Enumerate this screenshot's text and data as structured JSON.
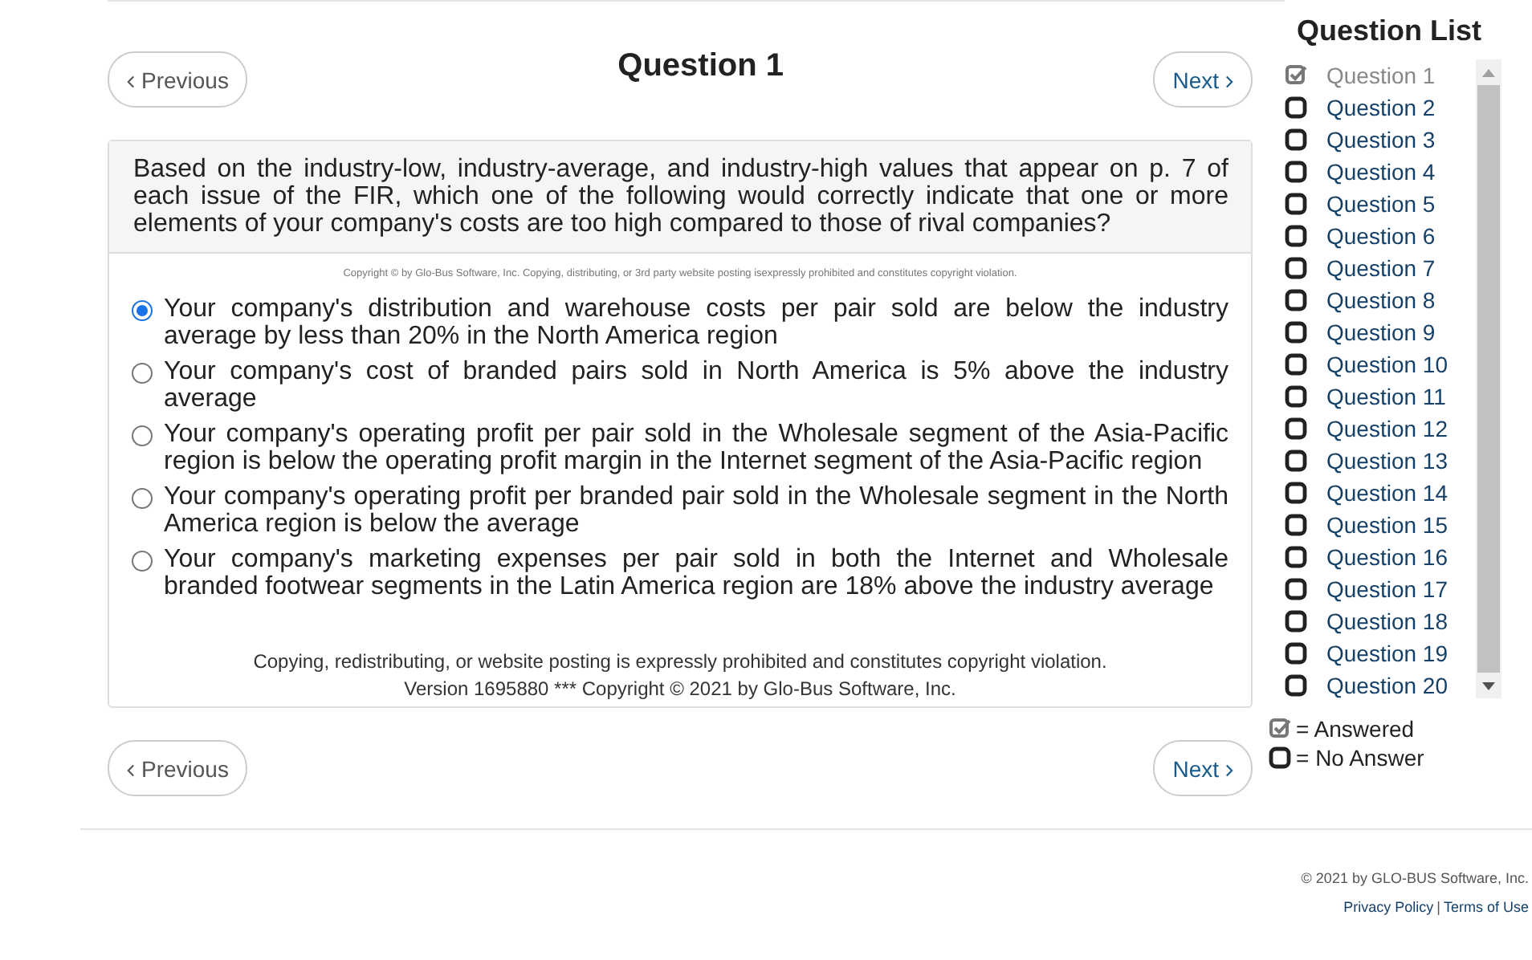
{
  "title": "Question 1",
  "nav_top": {
    "previous": "Previous",
    "next": "Next"
  },
  "question": {
    "text": "Based on the industry-low, industry-average, and industry-high values that appear on p. 7 of each issue of the FIR, which one of the following would correctly indicate that one or more elements of your company's costs are too high compared to those of rival companies?",
    "notice": "Copyright © by Glo-Bus Software, Inc. Copying, distributing, or 3rd party website posting isexpressly prohibited and constitutes copyright violation.",
    "options": [
      {
        "text": "Your company's distribution and warehouse costs per pair sold are below the industry average by less than 20% in the North America region",
        "selected": true
      },
      {
        "text": "Your company's cost of branded pairs sold in North America is 5% above the industry average",
        "selected": false
      },
      {
        "text": "Your company's operating profit per pair sold in the Wholesale segment of the Asia-Pacific region is below the operating profit margin in the Internet segment of the Asia-Pacific region",
        "selected": false
      },
      {
        "text": "Your company's operating profit per branded pair sold in the Wholesale segment in the North America region is below the average",
        "selected": false
      },
      {
        "text": "Your company's marketing expenses per pair sold in both the Internet and Wholesale branded footwear segments in the Latin America region are 18% above the industry average",
        "selected": false
      }
    ],
    "footer": [
      "Copying, redistributing, or website posting is expressly prohibited and constitutes copyright violation.",
      "Version 1695880 *** Copyright © 2021 by Glo-Bus Software, Inc."
    ]
  },
  "nav_bottom": {
    "previous": "Previous",
    "next": "Next"
  },
  "question_list": {
    "title": "Question List",
    "items": [
      {
        "label": "Question 1",
        "answered": true
      },
      {
        "label": "Question 2",
        "answered": false
      },
      {
        "label": "Question 3",
        "answered": false
      },
      {
        "label": "Question 4",
        "answered": false
      },
      {
        "label": "Question 5",
        "answered": false
      },
      {
        "label": "Question 6",
        "answered": false
      },
      {
        "label": "Question 7",
        "answered": false
      },
      {
        "label": "Question 8",
        "answered": false
      },
      {
        "label": "Question 9",
        "answered": false
      },
      {
        "label": "Question 10",
        "answered": false
      },
      {
        "label": "Question 11",
        "answered": false
      },
      {
        "label": "Question 12",
        "answered": false
      },
      {
        "label": "Question 13",
        "answered": false
      },
      {
        "label": "Question 14",
        "answered": false
      },
      {
        "label": "Question 15",
        "answered": false
      },
      {
        "label": "Question 16",
        "answered": false
      },
      {
        "label": "Question 17",
        "answered": false
      },
      {
        "label": "Question 18",
        "answered": false
      },
      {
        "label": "Question 19",
        "answered": false
      },
      {
        "label": "Question 20",
        "answered": false
      }
    ],
    "legend": [
      {
        "label": "= Answered",
        "answered": true
      },
      {
        "label": "= No Answer",
        "answered": false
      }
    ]
  },
  "page_footer": {
    "copyright": "© 2021 by GLO-BUS Software, Inc.",
    "links": [
      "Privacy Policy",
      "Terms of Use"
    ],
    "separator": "|"
  }
}
